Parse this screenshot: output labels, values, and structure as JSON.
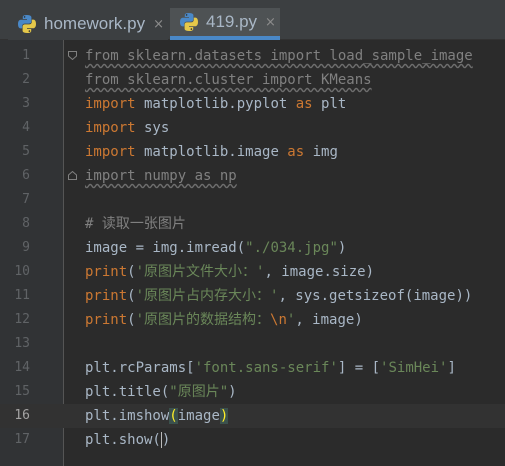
{
  "tabs": [
    {
      "label": "homework.py",
      "close": "×",
      "active": false
    },
    {
      "label": "419.py",
      "close": "×",
      "active": true
    }
  ],
  "editor": {
    "current_line": 16,
    "lines": [
      {
        "n": "1",
        "tokens": [
          {
            "t": "from sklearn.datasets import load_sample_image",
            "c": "warn"
          }
        ]
      },
      {
        "n": "2",
        "tokens": [
          {
            "t": "from sklearn.cluster import KMeans",
            "c": "warn"
          }
        ]
      },
      {
        "n": "3",
        "tokens": [
          {
            "t": "import",
            "c": "kw"
          },
          {
            "t": " matplotlib.pyplot ",
            "c": ""
          },
          {
            "t": "as",
            "c": "kw"
          },
          {
            "t": " plt",
            "c": ""
          }
        ]
      },
      {
        "n": "4",
        "tokens": [
          {
            "t": "import",
            "c": "kw"
          },
          {
            "t": " sys",
            "c": ""
          }
        ]
      },
      {
        "n": "5",
        "tokens": [
          {
            "t": "import",
            "c": "kw"
          },
          {
            "t": " matplotlib.image ",
            "c": ""
          },
          {
            "t": "as",
            "c": "kw"
          },
          {
            "t": " img",
            "c": ""
          }
        ]
      },
      {
        "n": "6",
        "tokens": [
          {
            "t": "import numpy as np",
            "c": "warn"
          }
        ]
      },
      {
        "n": "7",
        "tokens": []
      },
      {
        "n": "8",
        "tokens": [
          {
            "t": "# 读取一张图片",
            "c": "cmt"
          }
        ]
      },
      {
        "n": "9",
        "tokens": [
          {
            "t": "image = img.imread(",
            "c": ""
          },
          {
            "t": "\"./034.jpg\"",
            "c": "str"
          },
          {
            "t": ")",
            "c": ""
          }
        ]
      },
      {
        "n": "10",
        "tokens": [
          {
            "t": "print",
            "c": "kw"
          },
          {
            "t": "(",
            "c": ""
          },
          {
            "t": "'原图片文件大小：'",
            "c": "str"
          },
          {
            "t": ", image.size)",
            "c": ""
          }
        ]
      },
      {
        "n": "11",
        "tokens": [
          {
            "t": "print",
            "c": "kw"
          },
          {
            "t": "(",
            "c": ""
          },
          {
            "t": "'原图片占内存大小：'",
            "c": "str"
          },
          {
            "t": ", sys.getsizeof(image))",
            "c": ""
          }
        ]
      },
      {
        "n": "12",
        "tokens": [
          {
            "t": "print",
            "c": "kw"
          },
          {
            "t": "(",
            "c": ""
          },
          {
            "t": "'原图片的数据结构：",
            "c": "str"
          },
          {
            "t": "\\n",
            "c": "esc"
          },
          {
            "t": "'",
            "c": "str"
          },
          {
            "t": ", image)",
            "c": ""
          }
        ]
      },
      {
        "n": "13",
        "tokens": []
      },
      {
        "n": "14",
        "tokens": [
          {
            "t": "plt.rcParams[",
            "c": ""
          },
          {
            "t": "'font.sans-serif'",
            "c": "str"
          },
          {
            "t": "] = [",
            "c": ""
          },
          {
            "t": "'SimHei'",
            "c": "str"
          },
          {
            "t": "]",
            "c": ""
          }
        ]
      },
      {
        "n": "15",
        "tokens": [
          {
            "t": "plt.title(",
            "c": ""
          },
          {
            "t": "\"原图片\"",
            "c": "str"
          },
          {
            "t": ")",
            "c": ""
          }
        ]
      },
      {
        "n": "16",
        "tokens": [
          {
            "t": "plt.imshow",
            "c": ""
          },
          {
            "t": "(",
            "c": "brace"
          },
          {
            "t": "image",
            "c": ""
          },
          {
            "t": ")",
            "c": "brace"
          }
        ]
      },
      {
        "n": "17",
        "tokens": [
          {
            "t": "plt.show(",
            "c": ""
          },
          {
            "t": "|",
            "c": "caret"
          },
          {
            "t": ")",
            "c": ""
          }
        ]
      }
    ]
  },
  "colors": {
    "background": "#2b2b2b",
    "gutter": "#313335",
    "keyword": "#cc7832",
    "string": "#6a8759",
    "comment": "#808080",
    "text": "#a9b7c6",
    "tab_accent": "#4a88c7"
  },
  "icons": {
    "python_file": "python-file-icon",
    "close": "close-icon",
    "fold": "fold-marker-icon"
  }
}
